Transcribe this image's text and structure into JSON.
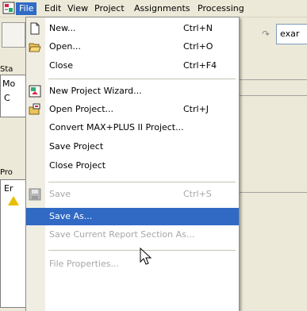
{
  "menubar": {
    "items": [
      "File",
      "Edit",
      "View",
      "Project",
      "Assignments",
      "Processing"
    ]
  },
  "toolbar": {
    "combo_value": "exar"
  },
  "background": {
    "panel_status_label": "Sta",
    "panel_status_row1": "Mo",
    "panel_status_row2": "C",
    "panel_project_label": "Pro",
    "panel_project_row1": "Er"
  },
  "file_menu": {
    "new": {
      "label": "New...",
      "shortcut": "Ctrl+N"
    },
    "open": {
      "label": "Open...",
      "shortcut": "Ctrl+O"
    },
    "close": {
      "label": "Close",
      "shortcut": "Ctrl+F4"
    },
    "new_project_wizard": {
      "label": "New Project Wizard..."
    },
    "open_project": {
      "label": "Open Project...",
      "shortcut": "Ctrl+J"
    },
    "convert": {
      "label": "Convert MAX+PLUS II Project..."
    },
    "save_project": {
      "label": "Save Project"
    },
    "close_project": {
      "label": "Close Project"
    },
    "save": {
      "label": "Save",
      "shortcut": "Ctrl+S"
    },
    "save_as": {
      "label": "Save As..."
    },
    "save_report": {
      "label": "Save Current Report Section As..."
    },
    "file_properties": {
      "label": "File Properties..."
    }
  },
  "colors": {
    "highlight": "#316ac5",
    "disabled_text": "#a7a6aa",
    "menubar_bg": "#ece9d8"
  }
}
